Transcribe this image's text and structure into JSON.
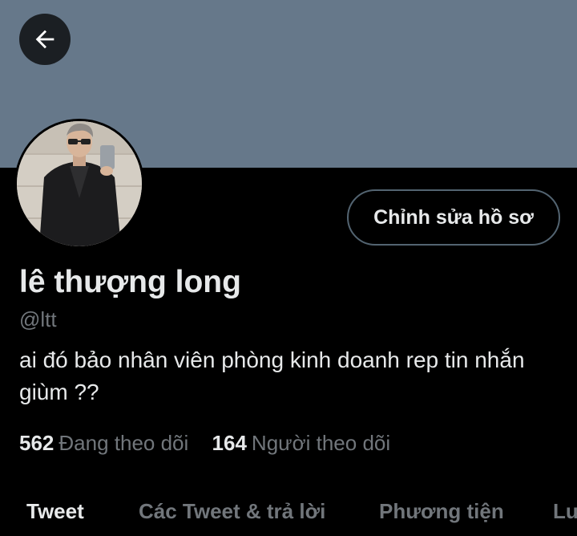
{
  "header": {
    "back_icon": "arrow-left-icon"
  },
  "profile": {
    "edit_button_label": "Chỉnh sửa hồ sơ",
    "display_name": "lê thượng long",
    "handle": "@ltt",
    "bio": "ai đó bảo nhân viên phòng kinh doanh rep tin nhắn giùm ??",
    "following_count": "562",
    "following_label": "Đang theo dõi",
    "followers_count": "164",
    "followers_label": "Người theo dõi"
  },
  "tabs": [
    {
      "label": "Tweet",
      "active": true
    },
    {
      "label": "Các Tweet & trả lời",
      "active": false
    },
    {
      "label": "Phương tiện",
      "active": false
    },
    {
      "label": "Lượt thích",
      "active": false
    }
  ],
  "colors": {
    "banner": "#66788a",
    "background": "#000000",
    "primary_text": "#e7e9ea",
    "secondary_text": "#71767b",
    "button_border": "#536471"
  }
}
